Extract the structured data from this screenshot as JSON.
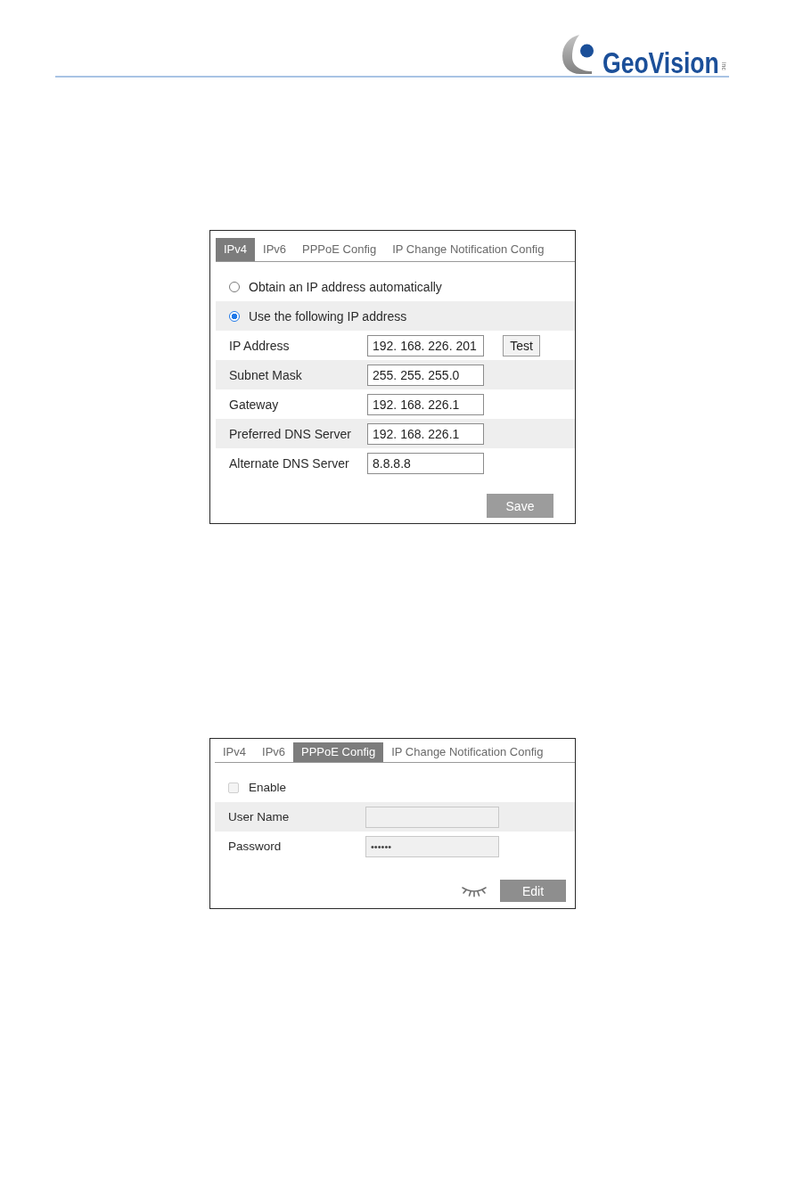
{
  "header": {
    "logo_text": "GeoVision",
    "logo_suffix": "inc"
  },
  "panels": [
    {
      "tabs": [
        {
          "label": "IPv4",
          "selected": true
        },
        {
          "label": "IPv6",
          "selected": false
        },
        {
          "label": "PPPoE Config",
          "selected": false
        },
        {
          "label": "IP Change Notification Config",
          "selected": false
        }
      ],
      "rows": [
        {
          "kind": "radio",
          "label": "Obtain an IP address automatically",
          "selected": false,
          "disabled": false
        },
        {
          "kind": "radio",
          "label": "Use the following IP address",
          "selected": true,
          "disabled": false
        },
        {
          "kind": "field",
          "label": "IP Address",
          "value": "192. 168. 226. 201",
          "button": "Test",
          "disabled": false
        },
        {
          "kind": "field",
          "label": "Subnet Mask",
          "value": "255. 255. 255.0",
          "disabled": false
        },
        {
          "kind": "field",
          "label": "Gateway",
          "value": "192. 168. 226.1",
          "disabled": false
        },
        {
          "kind": "field",
          "label": "Preferred DNS Server",
          "value": "192. 168. 226.1",
          "disabled": false
        },
        {
          "kind": "field",
          "label": "Alternate DNS Server",
          "value": "8.8.8.8",
          "disabled": false
        }
      ],
      "footer": [
        {
          "kind": "button",
          "label": "Save"
        }
      ]
    },
    {
      "tabs": [
        {
          "label": "IPv4",
          "selected": false
        },
        {
          "label": "IPv6",
          "selected": false
        },
        {
          "label": "PPPoE Config",
          "selected": true
        },
        {
          "label": "IP Change Notification Config",
          "selected": false
        }
      ],
      "rows": [
        {
          "kind": "checkbox",
          "label": "Enable",
          "checked": false,
          "disabled": true
        },
        {
          "kind": "field",
          "label": "User Name",
          "disabled": true
        },
        {
          "kind": "field",
          "label": "Password",
          "value": "••••••",
          "disabled": true
        }
      ],
      "footer": [
        {
          "kind": "reveal"
        },
        {
          "kind": "button",
          "label": "Edit"
        }
      ]
    }
  ]
}
